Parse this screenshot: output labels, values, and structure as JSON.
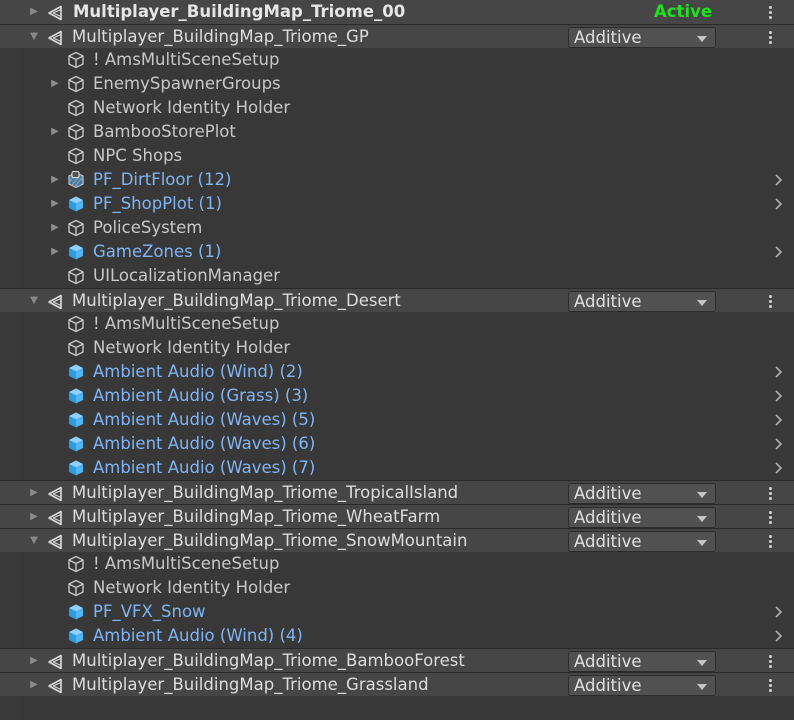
{
  "colors": {
    "background": "#383838",
    "scene_row_bg": "#464646",
    "prefab_text": "#7fb4f5",
    "active_green": "#1fe11f"
  },
  "icons": {
    "scene": "unity-scene-icon",
    "gameobject": "gameobject-cube-icon",
    "prefab": "prefab-cube-icon",
    "prefab_locked": "prefab-locked-icon"
  },
  "rows": [
    {
      "type": "scene",
      "label": "Multiplayer_BuildingMap_Triome_00",
      "expanded": false,
      "active": true,
      "badge": "Active"
    },
    {
      "type": "scene",
      "label": "Multiplayer_BuildingMap_Triome_GP",
      "expanded": true,
      "mode": "Additive"
    },
    {
      "type": "object",
      "label": "! AmsMultiSceneSetup"
    },
    {
      "type": "object",
      "label": "EnemySpawnerGroups",
      "hasChildren": true
    },
    {
      "type": "object",
      "label": "Network Identity Holder"
    },
    {
      "type": "object",
      "label": "BambooStorePlot",
      "hasChildren": true
    },
    {
      "type": "object",
      "label": "NPC Shops"
    },
    {
      "type": "prefab",
      "label": "PF_DirtFloor (12)",
      "hasChildren": true,
      "locked": true
    },
    {
      "type": "prefab",
      "label": "PF_ShopPlot (1)",
      "hasChildren": true
    },
    {
      "type": "object",
      "label": "PoliceSystem",
      "hasChildren": true
    },
    {
      "type": "prefab",
      "label": "GameZones (1)",
      "hasChildren": true
    },
    {
      "type": "object",
      "label": "UILocalizationManager"
    },
    {
      "type": "scene",
      "label": "Multiplayer_BuildingMap_Triome_Desert",
      "expanded": true,
      "mode": "Additive"
    },
    {
      "type": "object",
      "label": "! AmsMultiSceneSetup"
    },
    {
      "type": "object",
      "label": "Network Identity Holder"
    },
    {
      "type": "prefab",
      "label": "Ambient Audio (Wind) (2)"
    },
    {
      "type": "prefab",
      "label": "Ambient Audio (Grass) (3)"
    },
    {
      "type": "prefab",
      "label": "Ambient Audio (Waves) (5)"
    },
    {
      "type": "prefab",
      "label": "Ambient Audio (Waves) (6)"
    },
    {
      "type": "prefab",
      "label": "Ambient Audio (Waves) (7)"
    },
    {
      "type": "scene",
      "label": "Multiplayer_BuildingMap_Triome_TropicalIsland",
      "expanded": false,
      "mode": "Additive"
    },
    {
      "type": "scene",
      "label": "Multiplayer_BuildingMap_Triome_WheatFarm",
      "expanded": false,
      "mode": "Additive"
    },
    {
      "type": "scene",
      "label": "Multiplayer_BuildingMap_Triome_SnowMountain",
      "expanded": true,
      "mode": "Additive"
    },
    {
      "type": "object",
      "label": "! AmsMultiSceneSetup"
    },
    {
      "type": "object",
      "label": "Network Identity Holder"
    },
    {
      "type": "prefab",
      "label": "PF_VFX_Snow"
    },
    {
      "type": "prefab",
      "label": "Ambient Audio (Wind) (4)"
    },
    {
      "type": "scene",
      "label": "Multiplayer_BuildingMap_Triome_BambooForest",
      "expanded": false,
      "mode": "Additive"
    },
    {
      "type": "scene",
      "label": "Multiplayer_BuildingMap_Triome_Grassland",
      "expanded": false,
      "mode": "Additive"
    }
  ]
}
